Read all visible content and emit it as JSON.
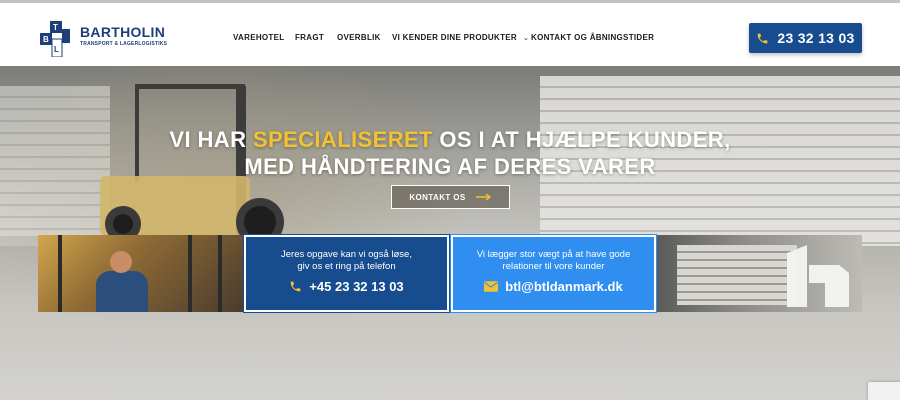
{
  "brand": {
    "name": "BARTHOLIN",
    "tagline": "TRANSPORT & LAGERLOGISTIKS",
    "monogram": [
      "B",
      "T",
      "L"
    ],
    "primary_color": "#174c8f",
    "accent_color": "#f2c230",
    "light_blue": "#2f8ef0"
  },
  "nav": {
    "items": [
      {
        "label": "VAREHOTEL"
      },
      {
        "label": "FRAGT"
      },
      {
        "label": "OVERBLIK"
      },
      {
        "label": "VI KENDER DINE PRODUKTER"
      },
      {
        "label": "KONTAKT OG ÅBNINGSTIDER"
      }
    ]
  },
  "header_phone": {
    "number": "23 32 13 03",
    "icon": "phone-icon"
  },
  "hero": {
    "line1_pre": "VI HAR ",
    "line1_highlight": "SPECIALISERET",
    "line1_post": " OS I AT HJÆLPE KUNDER,",
    "line2": "MED HÅNDTERING AF DERES VARER",
    "cta_label": "KONTAKT OS",
    "cta_icon": "arrow-right-icon"
  },
  "tiles": {
    "phone_tile": {
      "line1": "Jeres opgave kan vi også løse,",
      "line2": "giv os et ring på telefon",
      "contact": "+45 23 32 13 03",
      "icon": "phone-icon"
    },
    "email_tile": {
      "line1": "Vi lægger stor vægt på at have gode",
      "line2": "relationer til vore kunder",
      "contact": "btl@btldanmark.dk",
      "icon": "envelope-icon"
    }
  }
}
